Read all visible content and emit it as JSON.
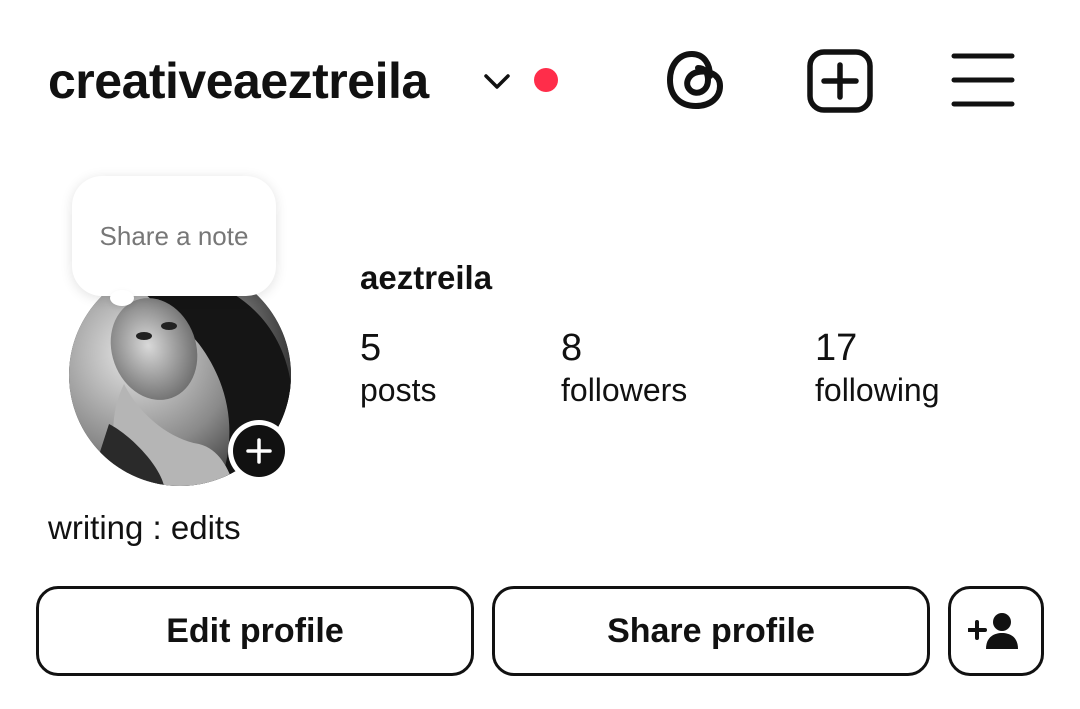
{
  "header": {
    "username": "creativeaeztreila",
    "notification_dot_color": "#ff2d4a",
    "icons": [
      "chevron-down-icon",
      "threads-icon",
      "new-post-icon",
      "menu-icon"
    ]
  },
  "note": {
    "placeholder": "Share a note"
  },
  "profile": {
    "display_name": "aeztreila",
    "bio": "writing : edits",
    "stats": [
      {
        "value": "5",
        "label": "posts"
      },
      {
        "value": "8",
        "label": "followers"
      },
      {
        "value": "17",
        "label": "following"
      }
    ]
  },
  "buttons": {
    "edit_profile": "Edit profile",
    "share_profile": "Share profile",
    "discover_people_icon": "add-person-icon"
  }
}
